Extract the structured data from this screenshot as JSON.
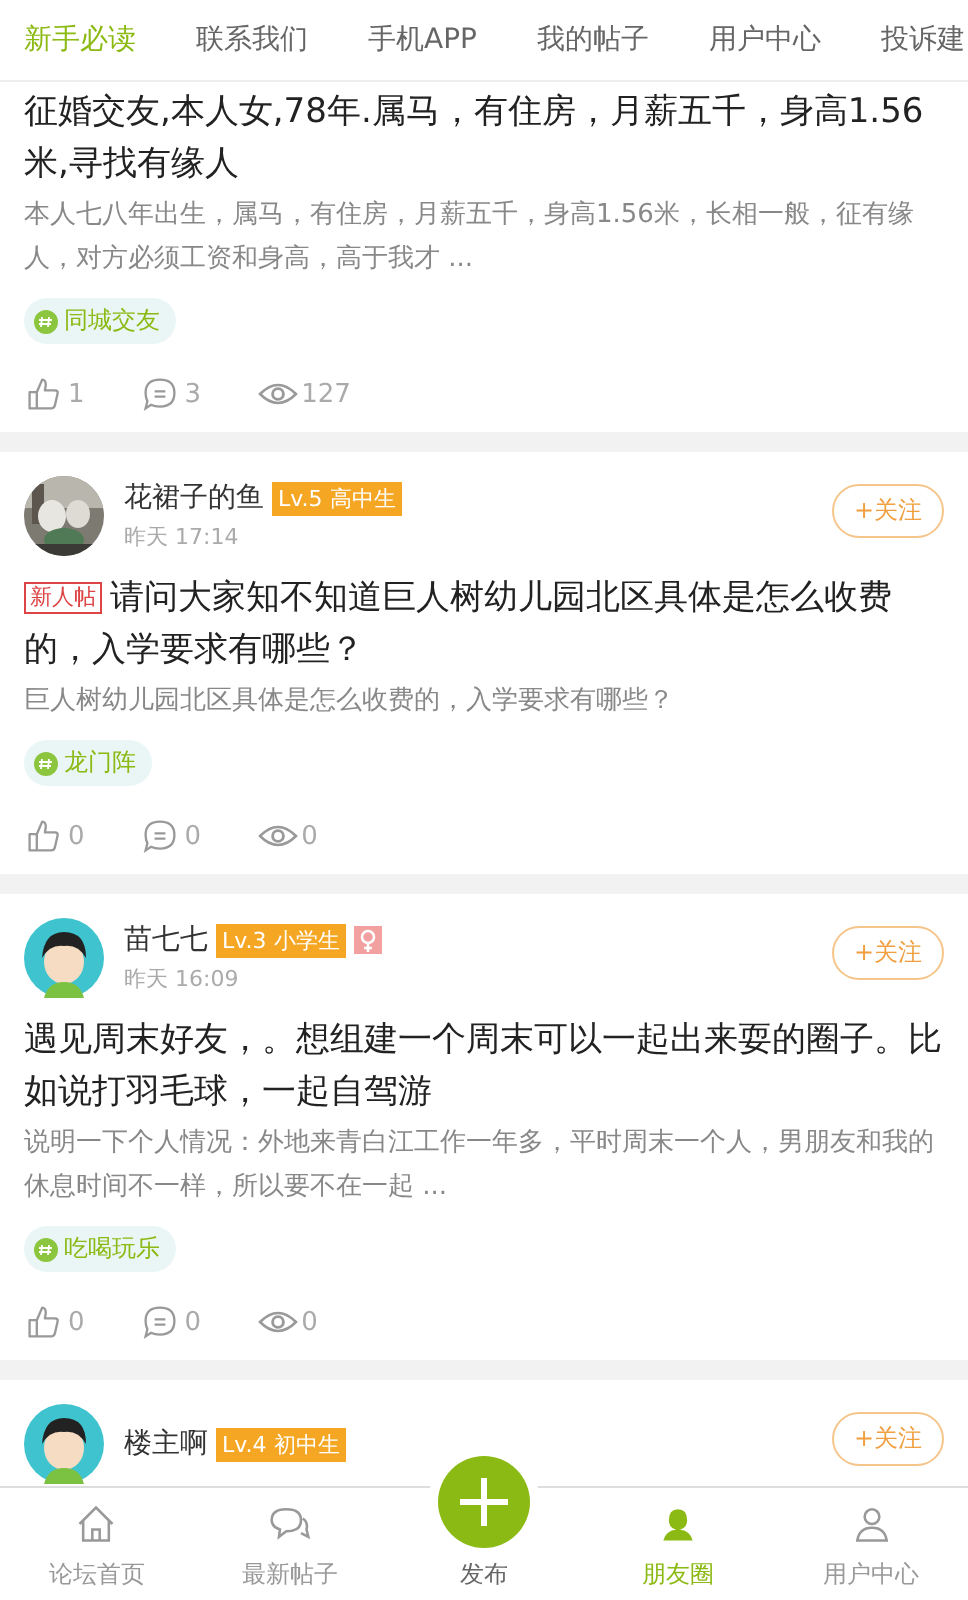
{
  "top_tabs": [
    {
      "label": "新手必读",
      "selected": true
    },
    {
      "label": "联系我们",
      "selected": false
    },
    {
      "label": "手机APP",
      "selected": false
    },
    {
      "label": "我的帖子",
      "selected": false
    },
    {
      "label": "用户中心",
      "selected": false
    },
    {
      "label": "投诉建",
      "selected": false
    }
  ],
  "posts": [
    {
      "title": "征婚交友,本人女,78年.属马，有住房，月薪五千，身高1.56米,寻找有缘人",
      "excerpt": "本人七八年出生，属马，有住房，月薪五千，身高1.56米，长相一般，征有缘人，对方必须工资和身高，高于我才 ...",
      "topic": "同城交友",
      "likes": "1",
      "comments": "3",
      "views": "127"
    },
    {
      "author": "花裙子的鱼",
      "level": "Lv.5 高中生",
      "time": "昨天 17:14",
      "follow": "+关注",
      "new_tag": "新人帖",
      "title": "请问大家知不知道巨人树幼儿园北区具体是怎么收费的，入学要求有哪些？",
      "excerpt": "巨人树幼儿园北区具体是怎么收费的，入学要求有哪些？",
      "topic": "龙门阵",
      "likes": "0",
      "comments": "0",
      "views": "0"
    },
    {
      "author": "苗七七",
      "avatar": {
        "kind": "cartoon"
      },
      "level": "Lv.3 小学生",
      "female": true,
      "time": "昨天 16:09",
      "follow": "+关注",
      "title": "遇见周末好友，。想组建一个周末可以一起出来耍的圈子。比如说打羽毛球，一起自驾游",
      "excerpt": "说明一下个人情况：外地来青白江工作一年多，平时周末一个人，男朋友和我的休息时间不一样，所以要不在一起 ...",
      "topic": "吃喝玩乐",
      "likes": "0",
      "comments": "0",
      "views": "0"
    },
    {
      "author": "楼主啊",
      "avatar": {
        "kind": "cartoon"
      },
      "level": "Lv.4 初中生",
      "follow": "+关注"
    }
  ],
  "bottom_nav": [
    {
      "kind": "home",
      "label": "论坛首页",
      "selected": false
    },
    {
      "kind": "chat",
      "label": "最新帖子",
      "selected": false
    },
    {
      "kind": "publish",
      "label": "发布",
      "selected": false
    },
    {
      "kind": "friends",
      "label": "朋友圈",
      "selected": true
    },
    {
      "kind": "user",
      "label": "用户中心",
      "selected": false
    }
  ]
}
